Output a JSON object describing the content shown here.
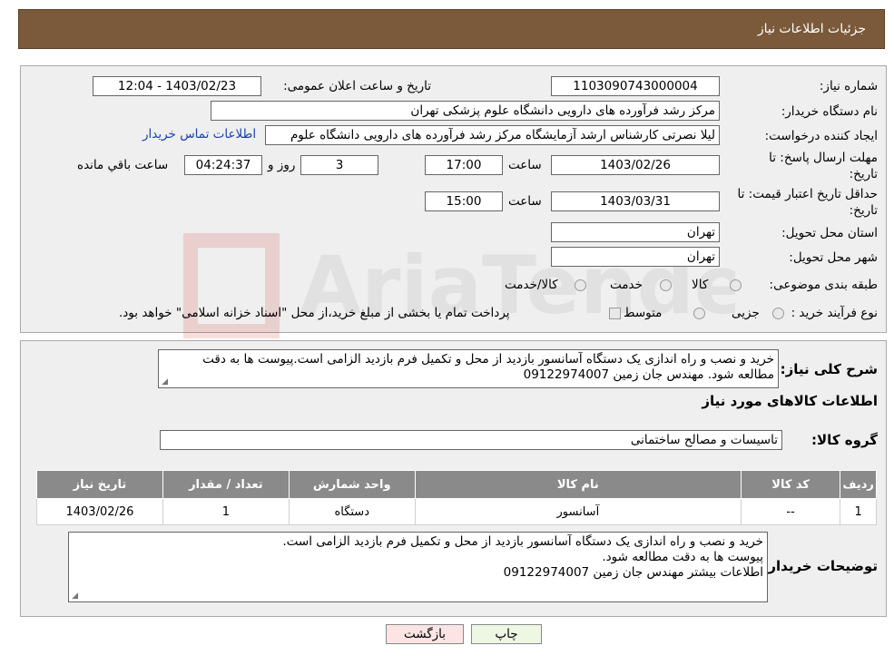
{
  "header": {
    "title": "جزئیات اطلاعات نیاز"
  },
  "form": {
    "need_number_label": "شماره نیاز:",
    "need_number": "1103090743000004",
    "announce_label": "تاریخ و ساعت اعلان عمومی:",
    "announce_value": "1403/02/23 - 12:04",
    "buyer_org_label": "نام دستگاه خریدار:",
    "buyer_org": "مرکز رشد فرآورده های دارویی دانشگاه علوم پزشکی تهران",
    "creator_label": "ایجاد کننده درخواست:",
    "creator": "لیلا نصرتی کارشناس ارشد آزمایشگاه مرکز رشد فرآورده های دارویی دانشگاه علوم",
    "contact_link": "اطلاعات تماس خریدار",
    "deadline_label_1": "مهلت ارسال پاسخ: تا",
    "deadline_label_2": "تاریخ:",
    "deadline_date": "1403/02/26",
    "time_label": "ساعت",
    "deadline_time": "17:00",
    "days_value": "3",
    "days_label": "روز و",
    "remaining_time": "04:24:37",
    "remaining_label": "ساعت باقي مانده",
    "validity_label_1": "حداقل تاریخ اعتبار قیمت: تا",
    "validity_label_2": "تاریخ:",
    "validity_date": "1403/03/31",
    "validity_time": "15:00",
    "province_label": "استان محل تحویل:",
    "province": "تهران",
    "city_label": "شهر محل تحویل:",
    "city": "تهران",
    "category_label": "طبقه بندی موضوعی:",
    "category_options": [
      "کالا",
      "خدمت",
      "کالا/خدمت"
    ],
    "purchase_label": "نوع فرآیند خرید :",
    "purchase_options": [
      "جزیی",
      "متوسط"
    ],
    "purchase_note": "پرداخت تمام یا بخشی از مبلغ خرید،از محل \"اسناد خزانه اسلامی\" خواهد بود."
  },
  "details": {
    "summary_label": "شرح کلی نیاز:",
    "summary": "خرید و نصب و راه اندازی یک دستگاه آسانسور بازدید از محل و تکمیل فرم بازدید الزامی است.پیوست ها به دقت مطالعه شود.  مهندس جان زمین 09122974007",
    "goods_info_label": "اطلاعات کالاهای مورد نیاز",
    "goods_group_label": "گروه کالا:",
    "goods_group": "تاسیسات و مصالح ساختمانی",
    "table_headers": [
      "ردیف",
      "کد کالا",
      "نام کالا",
      "واحد شمارش",
      "تعداد / مقدار",
      "تاریخ نیاز"
    ],
    "table_rows": [
      [
        "1",
        "--",
        "آسانسور",
        "دستگاه",
        "1",
        "1403/02/26"
      ]
    ],
    "buyer_notes_label": "توضیحات خریدار:",
    "buyer_notes_1": "خرید و نصب و راه اندازی یک دستگاه آسانسور بازدید از محل و تکمیل فرم بازدید الزامی است.",
    "buyer_notes_2": "پیوست ها به دقت مطالعه شود.",
    "buyer_notes_3": "اطلاعات بیشتر مهندس جان زمین 09122974007"
  },
  "buttons": {
    "print": "چاپ",
    "back": "بازگشت"
  },
  "watermark": {
    "text": "AriaTender.neT"
  }
}
